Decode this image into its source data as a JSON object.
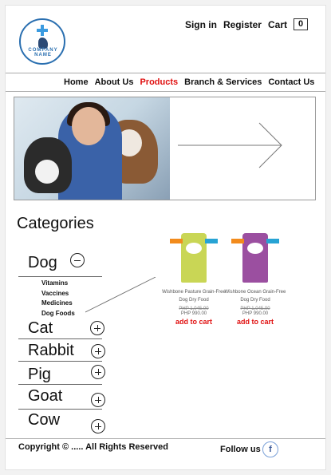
{
  "header": {
    "logo_text": "COMPANY NAME",
    "sign_in": "Sign in",
    "register": "Register",
    "cart": "Cart",
    "cart_count": "0"
  },
  "nav": [
    {
      "label": "Home",
      "active": false
    },
    {
      "label": "About Us",
      "active": false
    },
    {
      "label": "Products",
      "active": true
    },
    {
      "label": "Branch & Services",
      "active": false
    },
    {
      "label": "Contact Us",
      "active": false
    }
  ],
  "categories": {
    "title": "Categories",
    "items": [
      {
        "label": "Dog",
        "expanded": true,
        "icon": "minus-circle-icon"
      },
      {
        "label": "Cat",
        "expanded": false,
        "icon": "plus-circle-icon"
      },
      {
        "label": "Rabbit",
        "expanded": false,
        "icon": "plus-circle-icon"
      },
      {
        "label": "Pig",
        "expanded": false,
        "icon": "plus-circle-icon"
      },
      {
        "label": "Goat",
        "expanded": false,
        "icon": "plus-circle-icon"
      },
      {
        "label": "Cow",
        "expanded": false,
        "icon": "plus-circle-icon"
      }
    ],
    "dog_sub": [
      "Vitamins",
      "Vaccines",
      "Medicines",
      "Dog Foods"
    ]
  },
  "products": [
    {
      "name": "Wishbone Pasture Grain-Free Dog Dry Food",
      "old_price": "PHP 1,045.00",
      "price": "PHP 990.00",
      "add_to_cart": "add to cart",
      "color": "#c9d655"
    },
    {
      "name": "Wishbone Ocean Grain-Free Dog Dry Food",
      "old_price": "PHP 1,045.00",
      "price": "PHP 990.00",
      "add_to_cart": "add to cart",
      "color": "#9b4fa0"
    }
  ],
  "footer": {
    "copyright": "Copyright © ..... All Rights Reserved",
    "follow": "Follow us",
    "facebook": "f"
  },
  "colors": {
    "accent": "#e01010",
    "link_blue": "#2a6fb0"
  }
}
